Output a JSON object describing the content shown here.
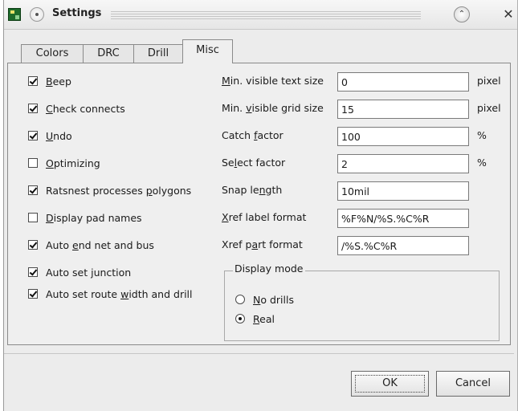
{
  "window": {
    "title": "Settings",
    "icons": {
      "app": "board-app-icon",
      "menu": "window-menu-icon",
      "shade": "chevron-up-icon",
      "close": "close-icon"
    },
    "close_glyph": "✕",
    "shade_glyph": "⌃"
  },
  "tabs": [
    {
      "label": "Colors",
      "active": false
    },
    {
      "label": "DRC",
      "active": false
    },
    {
      "label": "Drill",
      "active": false
    },
    {
      "label": "Misc",
      "active": true
    }
  ],
  "checkboxes": [
    {
      "pre": "",
      "u": "B",
      "post": "eep",
      "checked": true
    },
    {
      "pre": "",
      "u": "C",
      "post": "heck connects",
      "checked": true
    },
    {
      "pre": "",
      "u": "U",
      "post": "ndo",
      "checked": true
    },
    {
      "pre": "",
      "u": "O",
      "post": "ptimizing",
      "checked": false
    },
    {
      "pre": "Ratsnest processes ",
      "u": "p",
      "post": "olygons",
      "checked": true
    },
    {
      "pre": "",
      "u": "D",
      "post": "isplay pad names",
      "checked": false
    },
    {
      "pre": "Auto ",
      "u": "e",
      "post": "nd net and bus",
      "checked": true
    },
    {
      "pre": "Auto set ",
      "u": "j",
      "post": "unction",
      "checked": true
    },
    {
      "pre": "Auto set route ",
      "u": "w",
      "post": "idth and drill",
      "checked": true
    }
  ],
  "fields": [
    {
      "pre": "",
      "u": "M",
      "post": "in. visible text size",
      "value": "0",
      "unit": "pixel"
    },
    {
      "pre": "Min. ",
      "u": "v",
      "post": "isible grid size",
      "value": "15",
      "unit": "pixel"
    },
    {
      "pre": "Catch ",
      "u": "f",
      "post": "actor",
      "value": "100",
      "unit": "%"
    },
    {
      "pre": "Se",
      "u": "l",
      "post": "ect factor",
      "value": "2",
      "unit": "%"
    },
    {
      "pre": "Snap le",
      "u": "n",
      "post": "gth",
      "value": "10mil",
      "unit": ""
    },
    {
      "pre": "",
      "u": "X",
      "post": "ref label format",
      "value": "%F%N/%S.%C%R",
      "unit": ""
    },
    {
      "pre": "Xref p",
      "u": "a",
      "post": "rt format",
      "value": "/%S.%C%R",
      "unit": ""
    }
  ],
  "display_mode": {
    "title": "Display mode",
    "options": [
      {
        "pre": "",
        "u": "N",
        "post": "o drills",
        "selected": false
      },
      {
        "pre": "",
        "u": "R",
        "post": "eal",
        "selected": true
      }
    ]
  },
  "buttons": {
    "ok": "OK",
    "cancel": "Cancel"
  }
}
